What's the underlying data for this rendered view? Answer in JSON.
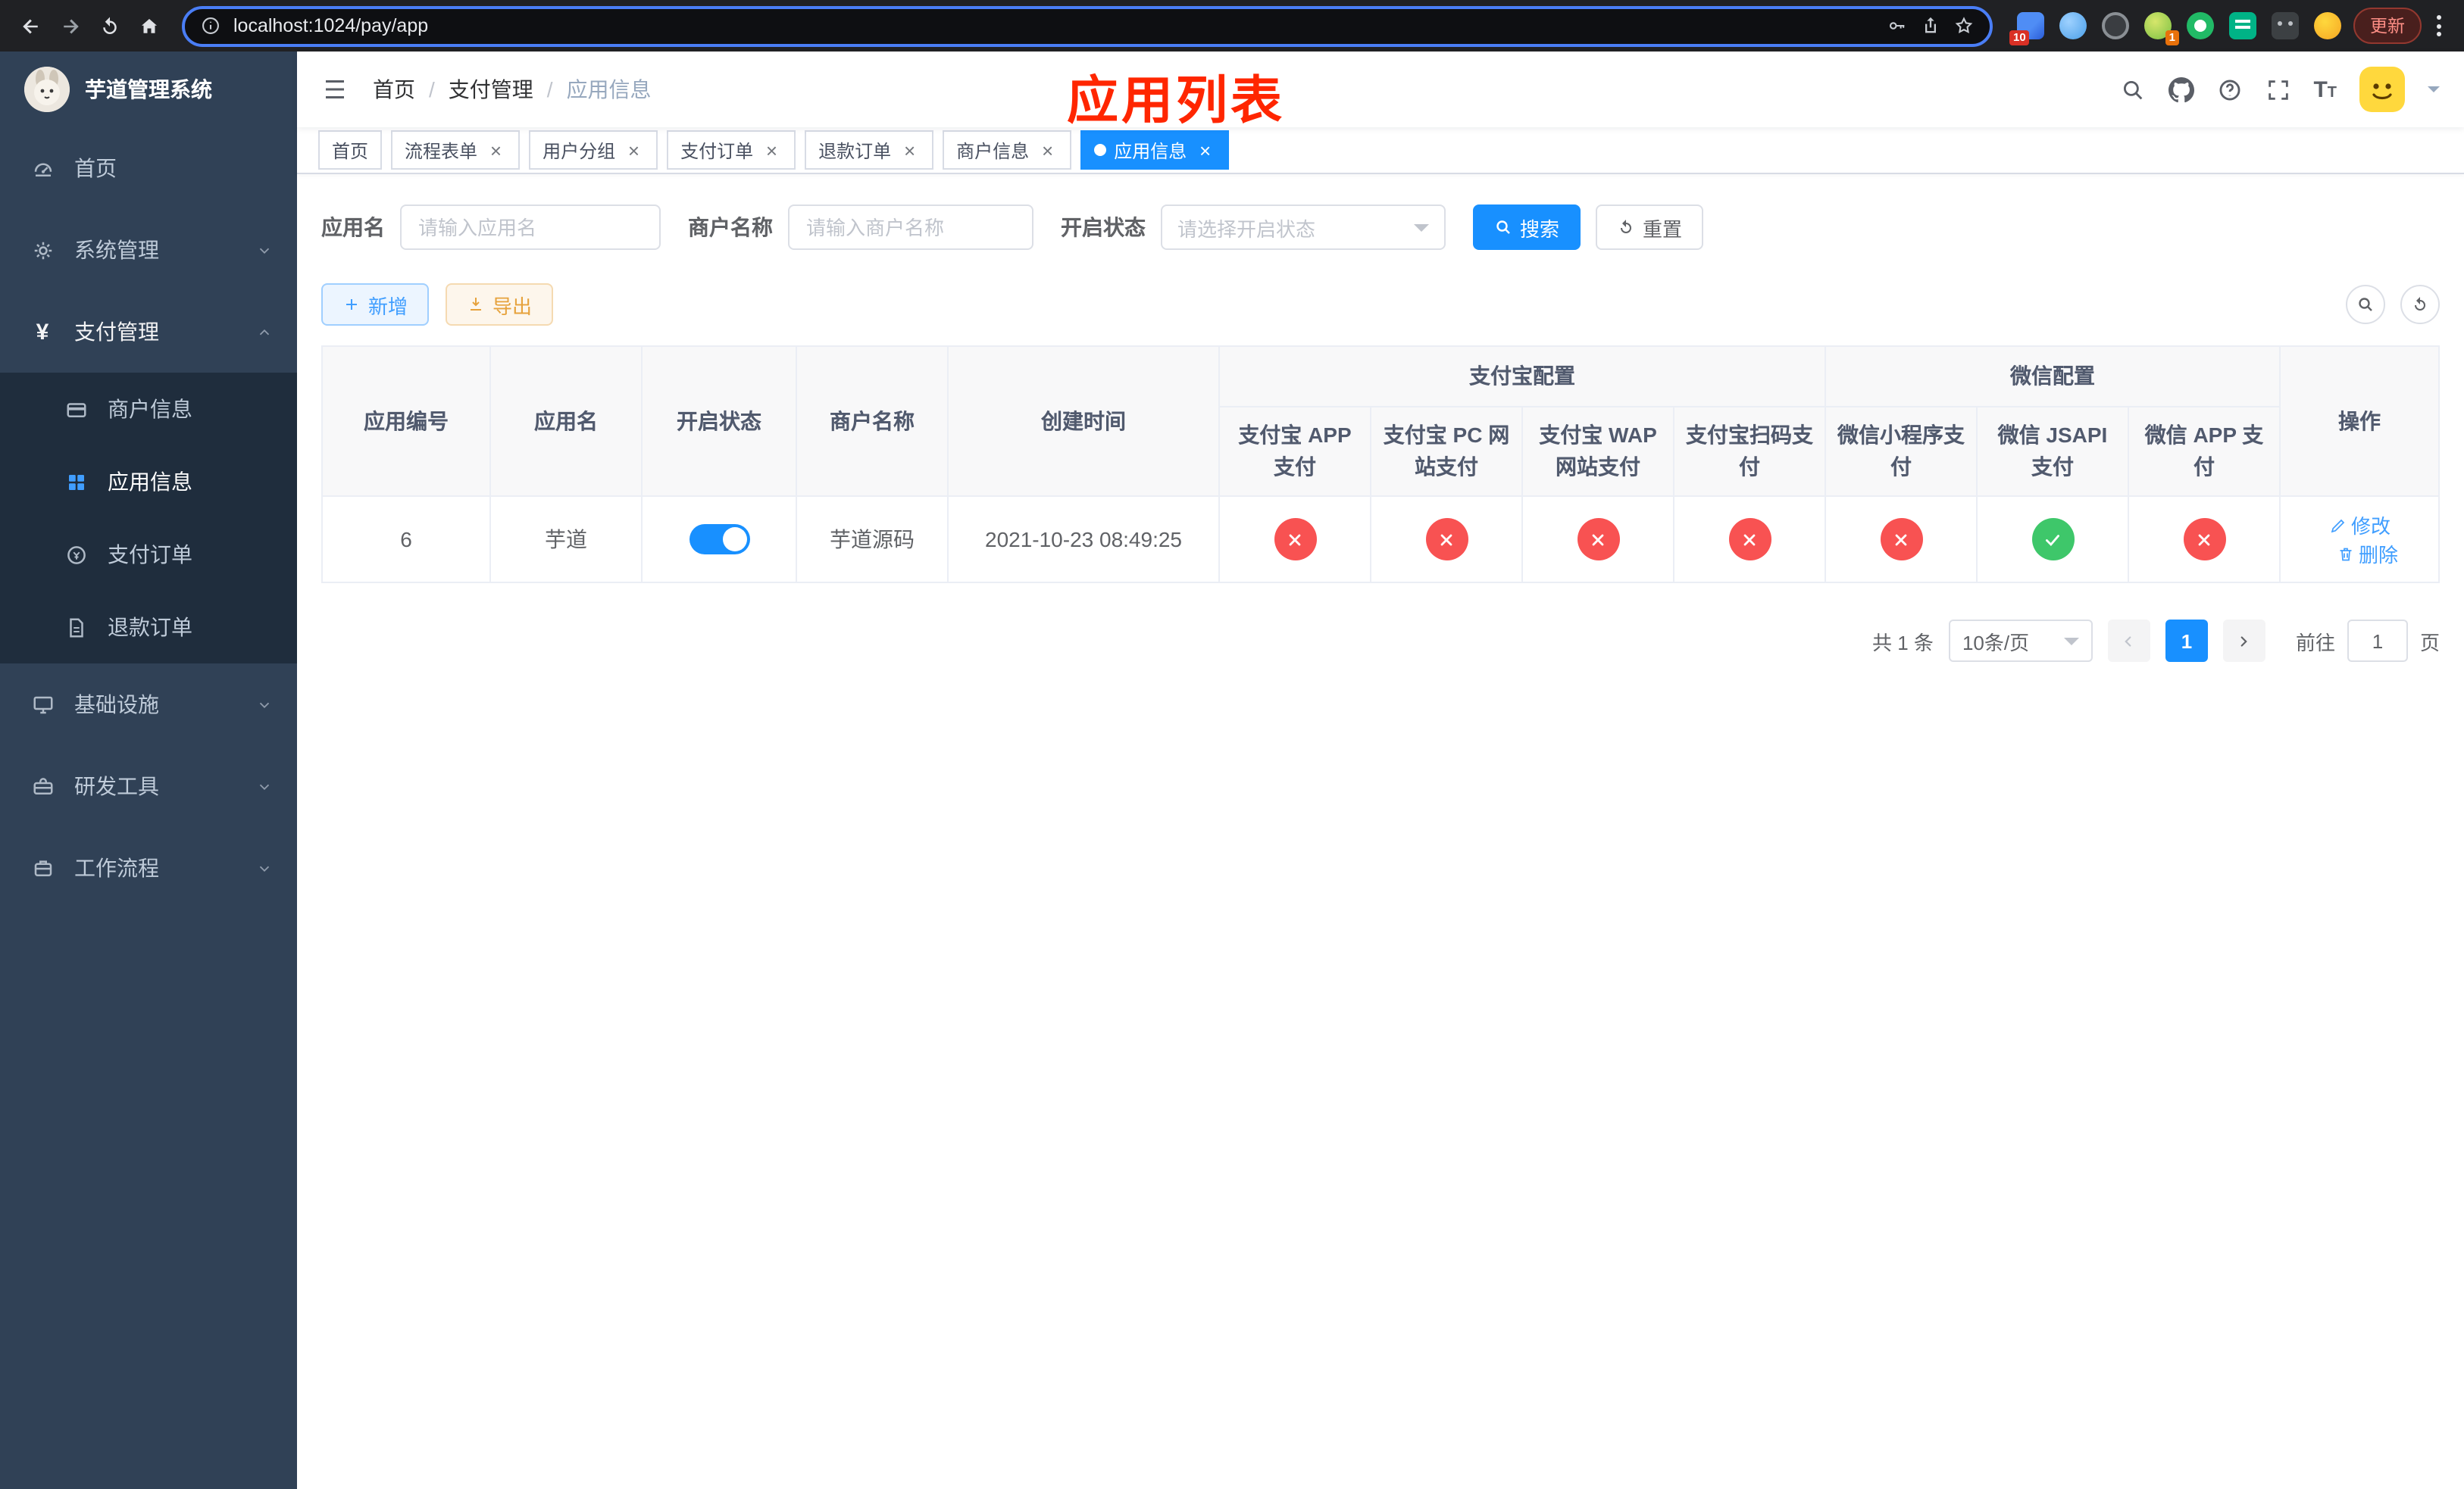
{
  "colors": {
    "accent": "#1890ff",
    "link_blue": "#409eff",
    "success": "#3ec76a",
    "danger": "#f85252",
    "warning": "#e6a23c",
    "sidebar_bg": "#304156",
    "submenu_bg": "#1f2d3d",
    "annotation_red": "#ff2600"
  },
  "browser": {
    "url": "localhost:1024/pay/app",
    "update_label": "更新",
    "extension_badge_1": "10",
    "extension_badge_2": "1"
  },
  "sidebar": {
    "title": "芋道管理系统",
    "items": {
      "home": "首页",
      "system": "系统管理",
      "payment": "支付管理",
      "merchant_info": "商户信息",
      "app_info": "应用信息",
      "pay_order": "支付订单",
      "refund_order": "退款订单",
      "infra": "基础设施",
      "dev_tools": "研发工具",
      "workflow": "工作流程"
    }
  },
  "navbar": {
    "breadcrumb": [
      "首页",
      "支付管理",
      "应用信息"
    ],
    "separator": "/",
    "annotation": "应用列表"
  },
  "tabs": [
    {
      "label": "首页"
    },
    {
      "label": "流程表单"
    },
    {
      "label": "用户分组"
    },
    {
      "label": "支付订单"
    },
    {
      "label": "退款订单"
    },
    {
      "label": "商户信息"
    },
    {
      "label": "应用信息"
    }
  ],
  "filters": {
    "app_name_label": "应用名",
    "app_name_placeholder": "请输入应用名",
    "app_name_value": "",
    "merchant_label": "商户名称",
    "merchant_placeholder": "请输入商户名称",
    "merchant_value": "",
    "status_label": "开启状态",
    "status_placeholder": "请选择开启状态",
    "search_label": "搜索",
    "reset_label": "重置"
  },
  "toolbar": {
    "add_label": "新增",
    "export_label": "导出"
  },
  "table": {
    "headers": {
      "app_id": "应用编号",
      "app_name": "应用名",
      "status": "开启状态",
      "merchant_name": "商户名称",
      "create_time": "创建时间",
      "alipay_group": "支付宝配置",
      "wechat_group": "微信配置",
      "alipay_app": "支付宝 APP 支付",
      "alipay_pc": "支付宝 PC 网站支付",
      "alipay_wap": "支付宝 WAP 网站支付",
      "alipay_qr": "支付宝扫码支付",
      "wx_lite": "微信小程序支付",
      "wx_jsapi": "微信 JSAPI 支付",
      "wx_app": "微信 APP 支付",
      "actions": "操作"
    },
    "rows": [
      {
        "app_id": "6",
        "app_name": "芋道",
        "enabled": true,
        "merchant_name": "芋道源码",
        "create_time": "2021-10-23 08:49:25",
        "alipay_app": false,
        "alipay_pc": false,
        "alipay_wap": false,
        "alipay_qr": false,
        "wx_lite": false,
        "wx_jsapi": true,
        "wx_app": false,
        "edit_label": "修改",
        "delete_label": "删除"
      }
    ]
  },
  "pagination": {
    "total": "共 1 条",
    "page_size": "10条/页",
    "page": "1",
    "goto_label": "前往",
    "goto_value": "1",
    "unit_label": "页"
  }
}
